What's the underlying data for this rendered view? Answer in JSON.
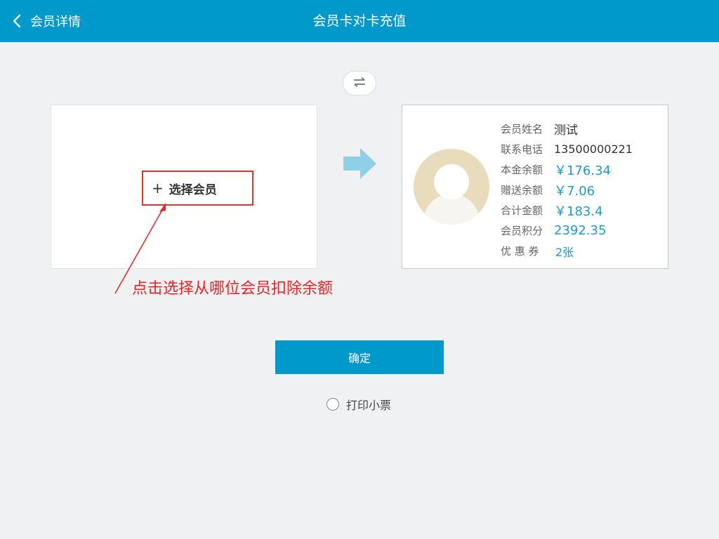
{
  "header": {
    "back_label": "会员详情",
    "title": "会员卡对卡充值"
  },
  "source_card": {
    "select_label": "选择会员",
    "plus_icon": "+"
  },
  "annotation": {
    "text": "点击选择从哪位会员扣除余额"
  },
  "target_card": {
    "rows": [
      {
        "label": "会员姓名",
        "value": "测试"
      },
      {
        "label": "联系电话",
        "value": "13500000221"
      },
      {
        "label": "本金余额",
        "value": "￥176.34"
      },
      {
        "label": "赠送余额",
        "value": "￥7.06"
      },
      {
        "label": "合计金额",
        "value": "￥183.4"
      },
      {
        "label": "会员积分",
        "value": "2392.35"
      },
      {
        "label": "优 惠 券",
        "value": "2张"
      }
    ]
  },
  "actions": {
    "confirm_label": "确定",
    "print_receipt_label": "打印小票"
  },
  "colors": {
    "brand": "#0099cc",
    "accent_value": "#1a9bd2",
    "annotation": "#ee2222",
    "avatar_bg": "#e9dcbd"
  },
  "icons": {
    "back": "chevron-left-icon",
    "swap": "swap-icon",
    "transfer": "arrow-right-icon",
    "avatar": "avatar-placeholder-icon"
  }
}
